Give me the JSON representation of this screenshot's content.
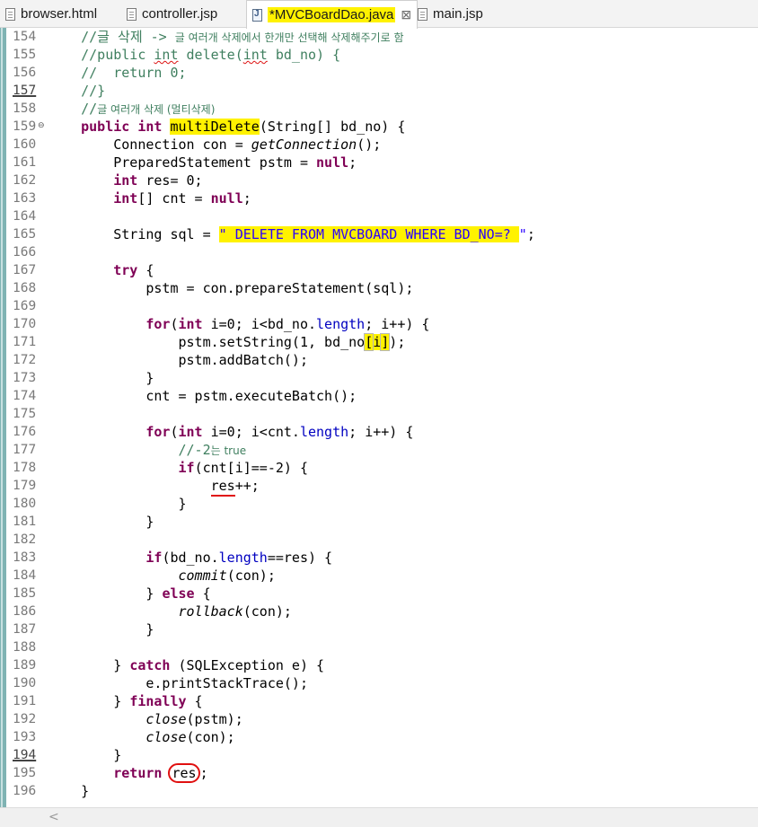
{
  "tabs": [
    {
      "label": "browser.html",
      "icon": "file-icon",
      "active": false
    },
    {
      "label": "controller.jsp",
      "icon": "file-icon",
      "active": false
    },
    {
      "label": "*MVCBoardDao.java",
      "icon": "java-file-icon",
      "active": true,
      "close": "⊠"
    },
    {
      "label": "main.jsp",
      "icon": "file-icon",
      "active": false
    }
  ],
  "line_numbers": [
    "154",
    "155",
    "156",
    "157",
    "158",
    "159",
    "160",
    "161",
    "162",
    "163",
    "164",
    "165",
    "166",
    "167",
    "168",
    "169",
    "170",
    "171",
    "172",
    "173",
    "174",
    "175",
    "176",
    "177",
    "178",
    "179",
    "180",
    "181",
    "182",
    "183",
    "184",
    "185",
    "186",
    "187",
    "188",
    "189",
    "190",
    "191",
    "192",
    "193",
    "194",
    "195",
    "196"
  ],
  "code": {
    "l154_a": "    //글 삭제 -> ",
    "l154_b": "글 여러개 삭제에서 한개만 선택해 삭제해주기로 함",
    "l155_a": "    //public ",
    "l155_b": "int",
    "l155_c": " delete(",
    "l155_d": "int",
    "l155_e": " bd_no) {",
    "l156": "    //  return 0;",
    "l157": "    //}",
    "l158_a": "    //",
    "l158_b": "글 여러개 삭제 (멀티삭제)",
    "l159_kw1": "public",
    "l159_kw2": "int",
    "l159_name": "multiDelete",
    "l159_rest": "(String[] bd_no) {",
    "l160_a": "        Connection con = ",
    "l160_b": "getConnection",
    "l160_c": "();",
    "l161_a": "        PreparedStatement pstm = ",
    "l161_b": "null",
    "l161_c": ";",
    "l162_a": "int",
    "l162_b": " res= 0;",
    "l163_a": "int",
    "l163_b": "[] cnt = ",
    "l163_c": "null",
    "l163_d": ";",
    "l165_a": "        String sql = ",
    "l165_b": "\" DELETE FROM MVCBOARD WHERE BD_NO=? ",
    "l165_c": "\"",
    "l165_d": ";",
    "l167_a": "try",
    "l167_b": " {",
    "l168": "            pstm = con.prepareStatement(sql);",
    "l170_a": "for",
    "l170_b": "(",
    "l170_c": "int",
    "l170_d": " i=0; i<bd_no.",
    "l170_e": "length",
    "l170_f": "; i++) {",
    "l171_a": "                pstm.setString(1, bd_no",
    "l171_b": "[",
    "l171_c": "i",
    "l171_d": "]",
    "l171_e": ");",
    "l172": "                pstm.addBatch();",
    "l173": "            }",
    "l174": "            cnt = pstm.executeBatch();",
    "l176_a": "for",
    "l176_b": "(",
    "l176_c": "int",
    "l176_d": " i=0; i<cnt.",
    "l176_e": "length",
    "l176_f": "; i++) {",
    "l177_a": "                //-2",
    "l177_b": "는 true",
    "l178_a": "if",
    "l178_b": "(cnt[i]==-2) {",
    "l179_a": "res",
    "l179_b": "++;",
    "l180": "                }",
    "l181": "            }",
    "l183_a": "if",
    "l183_b": "(bd_no.",
    "l183_c": "length",
    "l183_d": "==res) {",
    "l184_a": "commit",
    "l184_b": "(con);",
    "l185_a": "            } ",
    "l185_b": "else",
    "l185_c": " {",
    "l186_a": "rollback",
    "l186_b": "(con);",
    "l187": "            }",
    "l189_a": "        } ",
    "l189_b": "catch",
    "l189_c": " (SQLException e) {",
    "l190": "            e.printStackTrace();",
    "l191_a": "        } ",
    "l191_b": "finally",
    "l191_c": " {",
    "l192_a": "close",
    "l192_b": "(pstm);",
    "l193_a": "close",
    "l193_b": "(con);",
    "l194": "        }",
    "l195_a": "return",
    "l195_b": "res",
    "l195_c": ";",
    "l196": "    }"
  },
  "scroll_left": "<"
}
